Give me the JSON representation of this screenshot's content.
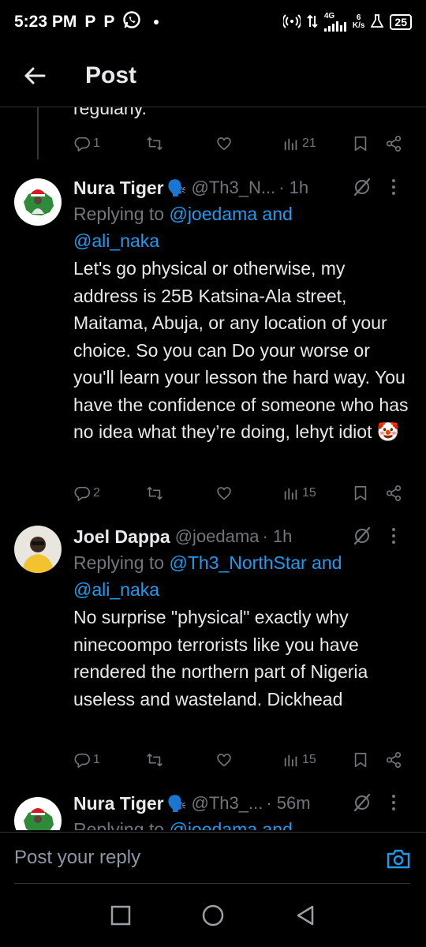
{
  "status_bar": {
    "time": "5:23 PM",
    "app_letters": [
      "P",
      "P"
    ],
    "network": "4G",
    "speed_value": "6",
    "speed_unit": "K/s",
    "battery": "25"
  },
  "header": {
    "title": "Post"
  },
  "partial_tweet": {
    "text": "regularly.",
    "replies": "1",
    "views": "21"
  },
  "tweets": [
    {
      "name": "Nura Tiger",
      "emoji": "🗣️",
      "handle": "@Th3_N...",
      "time": "· 1h",
      "reply_prefix": "Replying to ",
      "reply_links": "@joedama and",
      "reply_links2": "@ali_naka",
      "body": "Let's go physical or otherwise, my address is 25B Katsina-Ala street, Maitama, Abuja, or any location of your choice. So you can Do your worse or you'll learn your lesson the hard way. You have the confidence of someone who has no idea what they’re doing, lehyt idiot 🤡",
      "replies": "2",
      "views": "15"
    },
    {
      "name": "Joel Dappa",
      "handle": "@joedama",
      "time": "· 1h",
      "reply_prefix": "Replying to ",
      "reply_links": "@Th3_NorthStar and",
      "reply_links2": "@ali_naka",
      "body": "No surprise \"physical\" exactly why ninecoompo terrorists like you have rendered the northern part of Nigeria useless and wasteland. Dickhead",
      "replies": "1",
      "views": "15"
    },
    {
      "name": "Nura Tiger",
      "emoji": "🗣️",
      "handle": "@Th3_...",
      "time": "· 56m",
      "reply_prefix": "Replying to ",
      "reply_links": "@joedama and"
    }
  ],
  "reply_bar": {
    "placeholder": "Post your reply"
  },
  "colors": {
    "background": "#000000",
    "text": "#e7e9ea",
    "muted": "#71767b",
    "link": "#1d9bf0",
    "divider": "#2f3336"
  },
  "icons": {
    "back": "arrow-left-icon",
    "reply": "comment-icon",
    "retweet": "retweet-icon",
    "like": "heart-icon",
    "views": "bar-chart-icon",
    "bookmark": "bookmark-icon",
    "share": "share-icon",
    "grok": "grok-icon",
    "more": "more-vertical-icon",
    "camera": "camera-icon"
  }
}
